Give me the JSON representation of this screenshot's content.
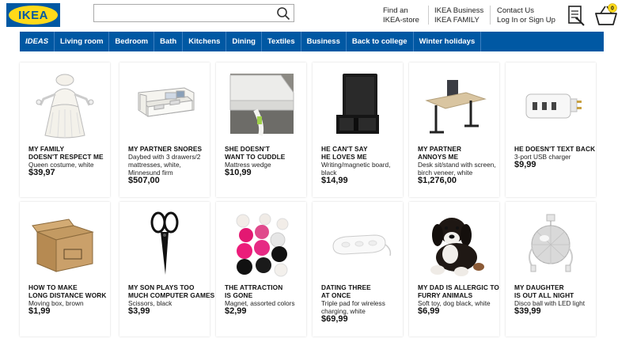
{
  "brand": {
    "logo_text": "IKEA",
    "color": "#0058a3",
    "accent": "#ffda1a"
  },
  "search": {
    "value": "",
    "placeholder": ""
  },
  "header_links": [
    {
      "line1": "Find an",
      "line2": "IKEA-store"
    },
    {
      "line1": "IKEA Business",
      "line2": "IKEA FAMILY"
    },
    {
      "line1": "Contact Us",
      "line2": "Log In or Sign Up"
    }
  ],
  "cart": {
    "count": "0"
  },
  "nav": [
    "IDEAS",
    "Living room",
    "Bedroom",
    "Bath",
    "Kitchens",
    "Dining",
    "Textiles",
    "Business",
    "Back to college",
    "Winter holidays"
  ],
  "products": [
    {
      "title": "MY FAMILY\nDOESN'T RESPECT ME",
      "desc": "Queen costume, white",
      "price": "$39,97",
      "icon": "costume-icon"
    },
    {
      "title": "MY PARTNER SNORES",
      "desc": "Daybed with 3 drawers/2\nmattresses, white,\nMinnesund firm",
      "price": "$507,00",
      "icon": "daybed-icon"
    },
    {
      "title": "SHE DOESN'T\nWANT TO CUDDLE",
      "desc": "Mattress wedge",
      "price": "$10,99",
      "icon": "mattress-wedge-icon"
    },
    {
      "title": "HE CAN'T SAY\nHE LOVES ME",
      "desc": "Writing/magnetic board,\nblack",
      "price": "$14,99",
      "icon": "board-icon"
    },
    {
      "title": "MY PARTNER\nANNOYS ME",
      "desc": "Desk sit/stand with screen,\nbirch veneer, white",
      "price": "$1,276,00",
      "icon": "desk-icon"
    },
    {
      "title": "HE DOESN'T TEXT BACK",
      "desc": "3-port USB charger",
      "price": "$9,99",
      "icon": "usb-charger-icon"
    },
    {
      "title": "HOW TO MAKE\nLONG DISTANCE WORK",
      "desc": "Moving box, brown",
      "price": "$1,99",
      "icon": "moving-box-icon"
    },
    {
      "title": "MY SON PLAYS TOO\nMUCH COMPUTER GAMES",
      "desc": "Scissors, black",
      "price": "$3,99",
      "icon": "scissors-icon"
    },
    {
      "title": "THE ATTRACTION\nIS GONE",
      "desc": "Magnet, assorted colors",
      "price": "$2,99",
      "icon": "magnets-icon"
    },
    {
      "title": "DATING THREE\nAT ONCE",
      "desc": "Triple pad for wireless\ncharging, white",
      "price": "$69,99",
      "icon": "charging-pad-icon"
    },
    {
      "title": "MY DAD IS ALLERGIC TO\nFURRY ANIMALS",
      "desc": "Soft toy, dog black, white",
      "price": "$6,99",
      "icon": "toy-dog-icon"
    },
    {
      "title": "MY DAUGHTER\nIS OUT ALL NIGHT",
      "desc": "Disco ball with LED light",
      "price": "$39,99",
      "icon": "disco-ball-icon"
    }
  ]
}
